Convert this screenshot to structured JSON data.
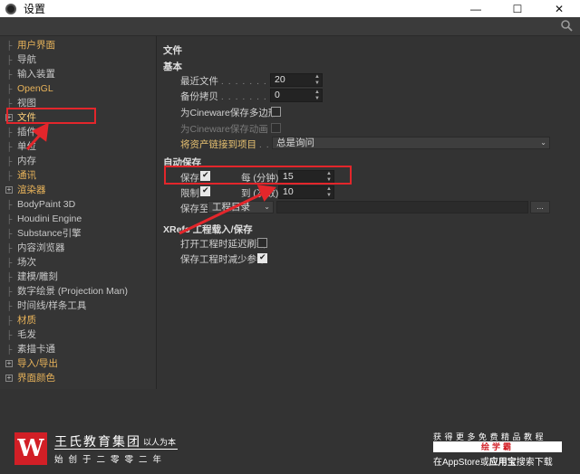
{
  "window": {
    "title": "设置",
    "minimize": "—",
    "maximize": "☐",
    "close": "✕"
  },
  "sidebar": {
    "items": [
      {
        "label": "用户界面",
        "style": "orange"
      },
      {
        "label": "导航",
        "style": "plain"
      },
      {
        "label": "输入装置",
        "style": "plain"
      },
      {
        "label": "OpenGL",
        "style": "orange"
      },
      {
        "label": "视图",
        "style": "plain"
      },
      {
        "label": "文件",
        "style": "orange",
        "expander": "+"
      },
      {
        "label": "插件",
        "style": "plain"
      },
      {
        "label": "单位",
        "style": "plain"
      },
      {
        "label": "内存",
        "style": "plain"
      },
      {
        "label": "通讯",
        "style": "orange"
      },
      {
        "label": "渲染器",
        "style": "orange",
        "expander": "+"
      },
      {
        "label": "BodyPaint 3D",
        "style": "plain"
      },
      {
        "label": "Houdini Engine",
        "style": "plain"
      },
      {
        "label": "Substance引擎",
        "style": "plain"
      },
      {
        "label": "内容浏览器",
        "style": "plain"
      },
      {
        "label": "场次",
        "style": "plain"
      },
      {
        "label": "建模/雕刻",
        "style": "plain"
      },
      {
        "label": "数字绘景 (Projection Man)",
        "style": "plain"
      },
      {
        "label": "时间线/样条工具",
        "style": "plain"
      },
      {
        "label": "材质",
        "style": "orange"
      },
      {
        "label": "毛发",
        "style": "plain"
      },
      {
        "label": "素描卡通",
        "style": "plain"
      },
      {
        "label": "导入/导出",
        "style": "orange",
        "expander": "+"
      },
      {
        "label": "界面颜色",
        "style": "orange",
        "expander": "+"
      }
    ]
  },
  "content": {
    "page_title": "文件",
    "basic": {
      "title": "基本",
      "recent_files_label": "最近文件",
      "recent_files_value": "20",
      "backup_label": "备份拷贝",
      "backup_value": "0",
      "cineware_poly_label": "为Cineware保存多边形",
      "cineware_anim_label": "为Cineware保存动画",
      "asset_link_label": "将资产链接到项目",
      "asset_link_value": "总是询问"
    },
    "autosave": {
      "title": "自动保存",
      "save_label": "保存",
      "every_label": "每 (分钟)",
      "every_value": "15",
      "limit_label": "限制",
      "to_label": "到 (次数)",
      "to_value": "10",
      "save_to_label": "保存至",
      "save_to_value": "工程目录",
      "browse_label": "..."
    },
    "xrefs": {
      "title": "XRefs 工程载入/保存",
      "delay_refresh_label": "打开工程时延迟刷新",
      "reduce_refs_label": "保存工程时减少参考"
    }
  },
  "footer": {
    "logo_letter": "W",
    "brand": "王氏教育集团",
    "slogan": "以人为本",
    "founded": "始创于二零零二年",
    "promo_line1": "获得更多免费精品教程",
    "promo_tag": "绘学霸",
    "promo_prefix": "在",
    "promo_store": "AppStore",
    "promo_or": "或",
    "promo_app": "应用宝",
    "promo_suffix": "搜索下载"
  },
  "colors": {
    "accent_orange": "#e8b35a",
    "annotation_red": "#e3262b",
    "brand_red": "#d21f26"
  }
}
